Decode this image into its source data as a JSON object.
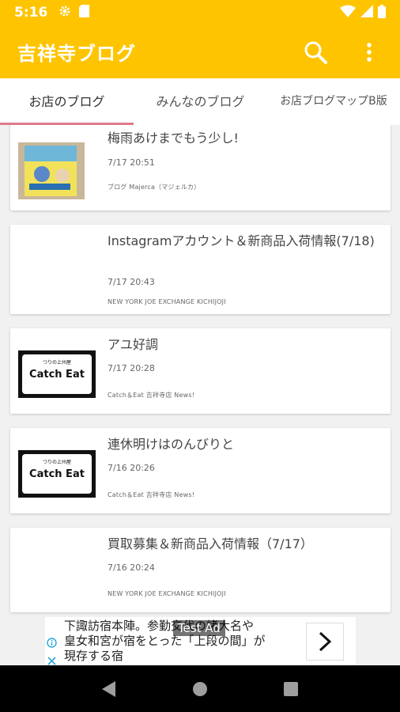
{
  "status_bar": {
    "time": "5:16"
  },
  "app_bar": {
    "title": "吉祥寺ブログ"
  },
  "tabs": [
    {
      "label": "お店のブログ",
      "active": true
    },
    {
      "label": "みんなのブログ",
      "active": false
    },
    {
      "label": "お店ブログマップB版",
      "active": false
    }
  ],
  "posts": [
    {
      "title": "梅雨あけまでもう少し!",
      "date": "7/17 20:51",
      "source": "ブログ Majerca（マジェルカ）",
      "thumb": "book-photo"
    },
    {
      "title": "Instagramアカウント＆新商品入荷情報(7/18)",
      "date": "7/17 20:43",
      "source": "NEW YORK JOE EXCHANGE KICHIJOJI",
      "thumb": "none"
    },
    {
      "title": "アユ好調",
      "date": "7/17 20:28",
      "source": "Catch＆Eat 吉祥寺店 News!",
      "thumb": "catch-eat-logo"
    },
    {
      "title": "連休明けはのんびりと",
      "date": "7/16 20:26",
      "source": "Catch＆Eat 吉祥寺店 News!",
      "thumb": "catch-eat-logo"
    },
    {
      "title": "買取募集＆新商品入荷情報（7/17）",
      "date": "7/16 20:24",
      "source": "NEW YORK JOE EXCHANGE KICHIJOJI",
      "thumb": "none"
    }
  ],
  "logo_text": {
    "catch_eat": "Catch Eat",
    "catch_eat_small": "つりの上州屋"
  },
  "ad": {
    "label": "Test Ad",
    "text_line1": "下諏訪宿本陣。参勤交代の諸大名や",
    "text_line2": "皇女和宮が宿をとった「上段の間」が",
    "text_line3": "現存する宿"
  },
  "colors": {
    "accent": "#ffc400",
    "tab_indicator": "#e07a8a"
  }
}
